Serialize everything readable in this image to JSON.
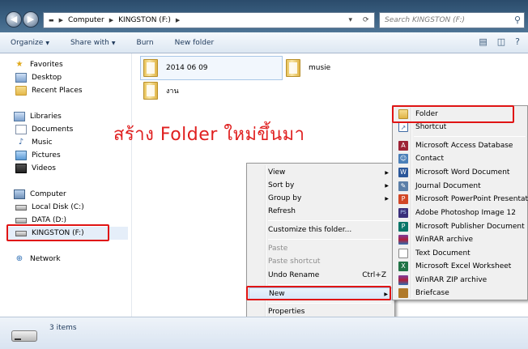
{
  "address": {
    "segments": [
      "Computer",
      "KINGSTON (F:)"
    ],
    "search_placeholder": "Search KINGSTON (F:)"
  },
  "toolbar": {
    "organize": "Organize",
    "share_with": "Share with",
    "burn": "Burn",
    "new_folder": "New folder"
  },
  "nav": {
    "favorites": "Favorites",
    "desktop": "Desktop",
    "recent_places": "Recent Places",
    "libraries": "Libraries",
    "documents": "Documents",
    "music": "Music",
    "pictures": "Pictures",
    "videos": "Videos",
    "computer": "Computer",
    "local_disk": "Local Disk (C:)",
    "data_drive": "DATA (D:)",
    "kingston": "KINGSTON (F:)",
    "network": "Network"
  },
  "content": {
    "items": [
      "2014 06 09",
      "musie",
      "งาน"
    ]
  },
  "annotation": "สร้าง Folder ใหม่ขึ้นมา",
  "context_menu": {
    "view": "View",
    "sort_by": "Sort by",
    "group_by": "Group by",
    "refresh": "Refresh",
    "customize": "Customize this folder...",
    "paste": "Paste",
    "paste_shortcut": "Paste shortcut",
    "undo_rename": "Undo Rename",
    "undo_shortcut": "Ctrl+Z",
    "new": "New",
    "properties": "Properties"
  },
  "new_submenu": {
    "folder": "Folder",
    "shortcut": "Shortcut",
    "access": "Microsoft Access Database",
    "contact": "Contact",
    "word": "Microsoft Word Document",
    "journal": "Journal Document",
    "powerpoint": "Microsoft PowerPoint Presentation",
    "photoshop": "Adobe Photoshop Image 12",
    "publisher": "Microsoft Publisher Document",
    "winrar": "WinRAR archive",
    "text": "Text Document",
    "excel": "Microsoft Excel Worksheet",
    "winrar_zip": "WinRAR ZIP archive",
    "briefcase": "Briefcase"
  },
  "status": {
    "count": "3 items"
  },
  "colors": {
    "annotation": "#e02020",
    "highlight_box": "#e01414",
    "toolbar_text": "#1e395b"
  }
}
